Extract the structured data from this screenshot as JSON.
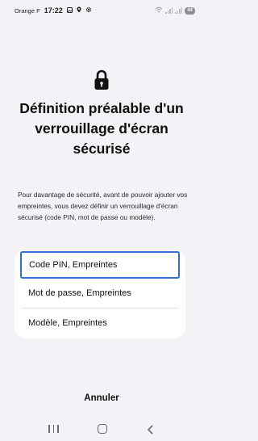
{
  "status_bar": {
    "carrier": "Orange F",
    "time": "17:22",
    "battery": "44",
    "icons": [
      "image-icon",
      "location-icon",
      "settings-icon",
      "wifi-icon",
      "signal-icon",
      "battery-icon"
    ]
  },
  "header": {
    "icon": "lock-icon",
    "title": "Définition préalable d'un verrouillage d'écran sécurisé"
  },
  "description": "Pour davantage de sécurité, avant de pouvoir ajouter vos empreintes, vous devez définir un verrouillage d'écran sécurisé (code PIN, mot de passe ou modèle).",
  "options": [
    {
      "label": "Code PIN, Empreintes",
      "selected": true
    },
    {
      "label": "Mot de passe, Empreintes",
      "selected": false
    },
    {
      "label": "Modèle, Empreintes",
      "selected": false
    }
  ],
  "footer": {
    "cancel_label": "Annuler"
  },
  "nav_bar": {
    "icons": [
      "recents-icon",
      "home-icon",
      "back-icon"
    ]
  },
  "colors": {
    "background": "#f3f2f7",
    "card": "#ffffff",
    "selection_border": "#2f6fd6"
  }
}
